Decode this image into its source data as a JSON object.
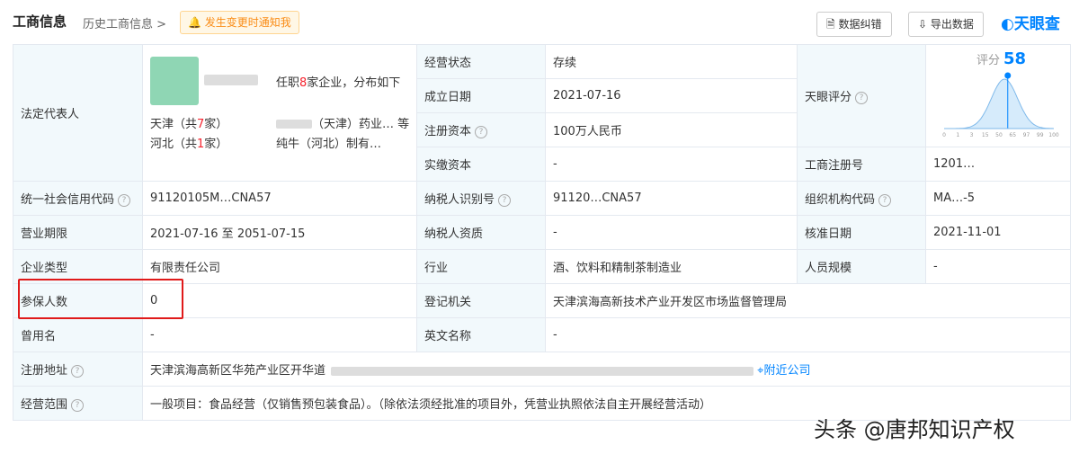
{
  "header": {
    "title": "工商信息",
    "history": "历史工商信息 >",
    "notify": "发生变更时通知我",
    "report_btn": "数据纠错",
    "export_btn": "导出数据",
    "logo": "天眼查"
  },
  "legal_rep": {
    "label": "法定代表人",
    "desc_prefix": "任职",
    "desc_count": "8",
    "desc_suffix": "家企业，分布如下",
    "r1": "天津（共",
    "r1_count": "7",
    "r1_suffix": "家）",
    "r2": "河北（共",
    "r2_count": "1",
    "r2_suffix": "家）",
    "c2a": "（天津）药业… 等",
    "c2b": "纯牛（河北）制有…"
  },
  "rows": {
    "status_label": "经营状态",
    "status_value": "存续",
    "estab_label": "成立日期",
    "estab_value": "2021-07-16",
    "capital_label": "注册资本",
    "capital_value": "100万人民币",
    "paidin_label": "实缴资本",
    "paidin_value": "-",
    "score_label": "天眼评分",
    "score_title": "评分",
    "score_value": "58",
    "regno_label": "工商注册号",
    "regno_value": "1201…",
    "uscc_label": "统一社会信用代码",
    "uscc_value": "91120105M…CNA57",
    "taxid_label": "纳税人识别号",
    "taxid_value": "91120…CNA57",
    "orgcode_label": "组织机构代码",
    "orgcode_value": "MA…-5",
    "period_label": "营业期限",
    "period_value": "2021-07-16 至 2051-07-15",
    "taxqual_label": "纳税人资质",
    "taxqual_value": "-",
    "approve_label": "核准日期",
    "approve_value": "2021-11-01",
    "type_label": "企业类型",
    "type_value": "有限责任公司",
    "industry_label": "行业",
    "industry_value": "酒、饮料和精制茶制造业",
    "staff_label": "人员规模",
    "staff_value": "-",
    "insured_label": "参保人数",
    "insured_value": "0",
    "regauth_label": "登记机关",
    "regauth_value": "天津滨海高新技术产业开发区市场监督管理局",
    "formername_label": "曾用名",
    "formername_value": "-",
    "engname_label": "英文名称",
    "engname_value": "-",
    "address_label": "注册地址",
    "address_value": "天津滨海高新区华苑产业区开华道",
    "address_link": "附近公司",
    "scope_label": "经营范围",
    "scope_value": "一般项目：食品经营（仅销售预包装食品）。（除依法须经批准的项目外，凭营业执照依法自主开展经营活动）"
  },
  "score_chart": {
    "score": 58,
    "x_ticks": [
      "0",
      "1",
      "3",
      "15",
      "50",
      "65",
      "97",
      "99",
      "100"
    ]
  },
  "watermark": "头条 @唐邦知识产权"
}
